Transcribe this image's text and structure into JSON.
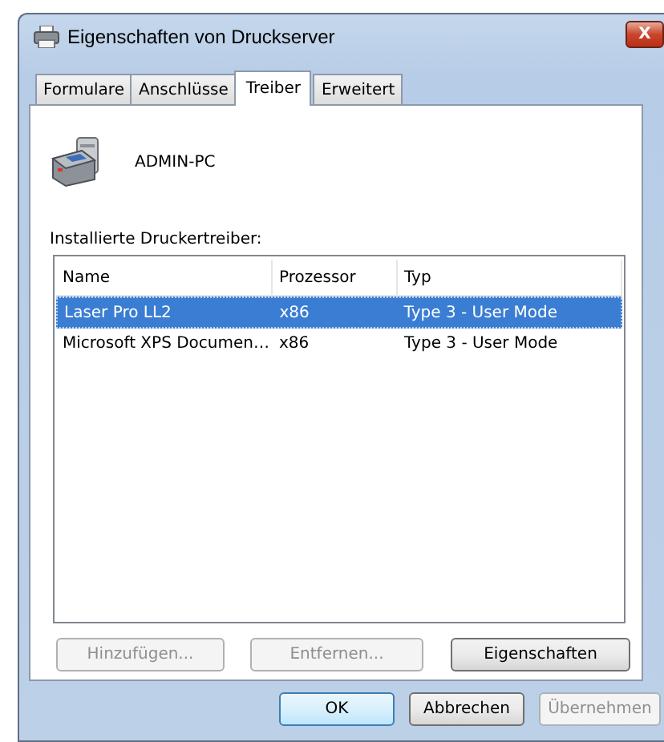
{
  "window": {
    "title": "Eigenschaften von Druckserver",
    "close": "X"
  },
  "tabs": [
    {
      "label": "Formulare",
      "selected": false
    },
    {
      "label": "Anschlüsse",
      "selected": false
    },
    {
      "label": "Treiber",
      "selected": true
    },
    {
      "label": "Erweitert",
      "selected": false
    }
  ],
  "server": {
    "name": "ADMIN-PC"
  },
  "drivers": {
    "label": "Installierte Druckertreiber:",
    "columns": [
      "Name",
      "Prozessor",
      "Typ"
    ],
    "rows": [
      {
        "cells": [
          "Laser Pro LL2",
          "x86",
          "Type 3 - User Mode"
        ],
        "selected": true
      },
      {
        "cells": [
          "Microsoft XPS Documen…",
          "x86",
          "Type 3 - User Mode"
        ],
        "selected": false
      }
    ]
  },
  "panel_buttons": [
    {
      "label": "Hinzufügen...",
      "disabled": true
    },
    {
      "label": "Entfernen...",
      "disabled": true
    },
    {
      "label": "Eigenschaften",
      "disabled": false
    }
  ],
  "dialog_buttons": [
    {
      "label": "OK",
      "disabled": false,
      "default": true
    },
    {
      "label": "Abbrechen",
      "disabled": false,
      "default": false
    },
    {
      "label": "Übernehmen",
      "disabled": true,
      "default": false
    }
  ]
}
